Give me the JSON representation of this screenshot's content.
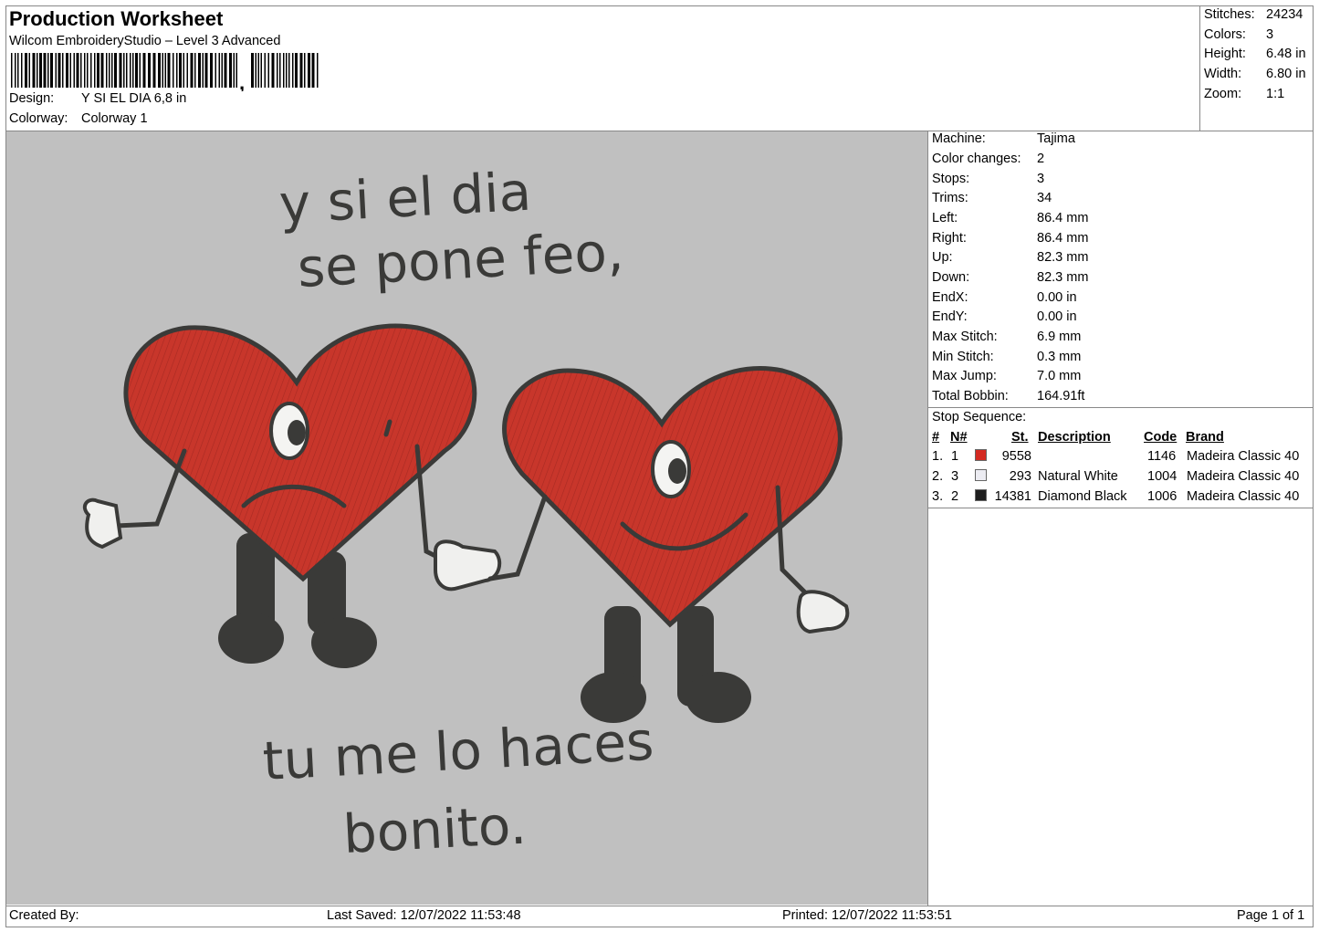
{
  "header": {
    "title": "Production Worksheet",
    "software": "Wilcom EmbroideryStudio – Level 3 Advanced",
    "barcode_icon": "barcode-icon",
    "design_label": "Design:",
    "design_value": "Y SI EL DIA 6,8 in",
    "colorway_label": "Colorway:",
    "colorway_value": "Colorway 1"
  },
  "summary": {
    "stitches_label": "Stitches:",
    "stitches": "24234",
    "colors_label": "Colors:",
    "colors": "3",
    "height_label": "Height:",
    "height": "6.48 in",
    "width_label": "Width:",
    "width": "6.80 in",
    "zoom_label": "Zoom:",
    "zoom": "1:1"
  },
  "design": {
    "text_top_1": "y si el dia",
    "text_top_2": "se pone feo,",
    "text_bottom_1": "tu me lo haces",
    "text_bottom_2": "bonito.",
    "heart_color": "#c8362b",
    "outline_color": "#3a3a38",
    "background": "#c0c0c0"
  },
  "machine": {
    "machine_label": "Machine:",
    "machine": "Tajima",
    "color_changes_label": "Color changes:",
    "color_changes": "2",
    "stops_label": "Stops:",
    "stops": "3",
    "trims_label": "Trims:",
    "trims": "34",
    "left_label": "Left:",
    "left": "86.4 mm",
    "right_label": "Right:",
    "right": "86.4 mm",
    "up_label": "Up:",
    "up": "82.3 mm",
    "down_label": "Down:",
    "down": "82.3 mm",
    "endx_label": "EndX:",
    "endx": "0.00 in",
    "endy_label": "EndY:",
    "endy": "0.00 in",
    "max_stitch_label": "Max Stitch:",
    "max_stitch": "6.9 mm",
    "min_stitch_label": "Min Stitch:",
    "min_stitch": "0.3 mm",
    "max_jump_label": "Max Jump:",
    "max_jump": "7.0 mm",
    "total_bobbin_label": "Total Bobbin:",
    "total_bobbin": "164.91ft"
  },
  "stop_sequence": {
    "title": "Stop Sequence:",
    "headers": {
      "num": "#",
      "n": "N#",
      "st": "St.",
      "description": "Description",
      "code": "Code",
      "brand": "Brand"
    },
    "rows": [
      {
        "num": "1.",
        "n": "1",
        "color": "#d42a22",
        "st": "9558",
        "description": "",
        "code": "1146",
        "brand": "Madeira Classic 40"
      },
      {
        "num": "2.",
        "n": "3",
        "color": "#ececf2",
        "st": "293",
        "description": "Natural White",
        "code": "1004",
        "brand": "Madeira Classic 40"
      },
      {
        "num": "3.",
        "n": "2",
        "color": "#1e1e1e",
        "st": "14381",
        "description": "Diamond Black",
        "code": "1006",
        "brand": "Madeira Classic 40"
      }
    ]
  },
  "footer": {
    "created_by": "Created By:",
    "last_saved": "Last Saved: 12/07/2022 11:53:48",
    "printed": "Printed: 12/07/2022 11:53:51",
    "page": "Page 1 of 1"
  }
}
